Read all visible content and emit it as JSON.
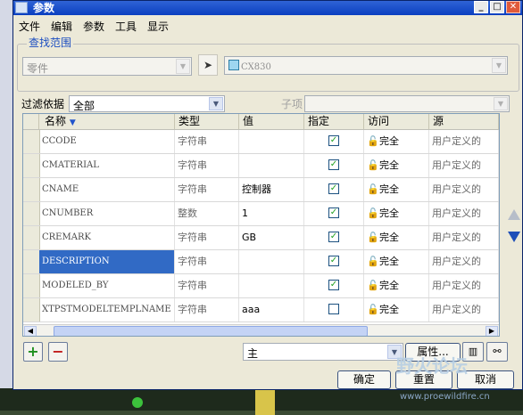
{
  "window": {
    "title": "参数",
    "controls": {
      "minimize": "_",
      "maximize": "□",
      "close": "✕"
    }
  },
  "menu": {
    "items": [
      "文件",
      "编辑",
      "参数",
      "工具",
      "显示"
    ]
  },
  "scope": {
    "legend": "查找范围",
    "type_value": "零件",
    "model_value": "CX830"
  },
  "filter": {
    "label": "过滤依据",
    "value": "全部",
    "subitem_label": "子项"
  },
  "table": {
    "columns": [
      "名称",
      "类型",
      "值",
      "指定",
      "访问",
      "源"
    ],
    "rows": [
      {
        "name": "CCODE",
        "type": "字符串",
        "value": "",
        "designated": true,
        "access": "完全",
        "source": "用户定义的"
      },
      {
        "name": "CMATERIAL",
        "type": "字符串",
        "value": "",
        "designated": true,
        "access": "完全",
        "source": "用户定义的"
      },
      {
        "name": "CNAME",
        "type": "字符串",
        "value": "控制器",
        "designated": true,
        "access": "完全",
        "source": "用户定义的"
      },
      {
        "name": "CNUMBER",
        "type": "整数",
        "value": "1",
        "designated": true,
        "access": "完全",
        "source": "用户定义的"
      },
      {
        "name": "CREMARK",
        "type": "字符串",
        "value": "GB",
        "designated": true,
        "access": "完全",
        "source": "用户定义的"
      },
      {
        "name": "DESCRIPTION",
        "type": "字符串",
        "value": "",
        "designated": true,
        "access": "完全",
        "source": "用户定义的",
        "selected": true
      },
      {
        "name": "MODELED_BY",
        "type": "字符串",
        "value": "",
        "designated": true,
        "access": "完全",
        "source": "用户定义的"
      },
      {
        "name": "XTPSTMODELTEMPLNAME",
        "type": "字符串",
        "value": "aaa",
        "designated": false,
        "access": "完全",
        "source": "用户定义的"
      }
    ]
  },
  "bottom": {
    "add": "+",
    "remove": "−",
    "view_value": "主",
    "properties": "属性...",
    "ok": "确定",
    "reset": "重置",
    "cancel": "取消"
  },
  "watermark": {
    "text": "野火论坛",
    "url": "www.proewildfire.cn"
  },
  "colors": {
    "accent": "#316ac5",
    "title": "#0a3fc0",
    "check": "#21a121"
  }
}
